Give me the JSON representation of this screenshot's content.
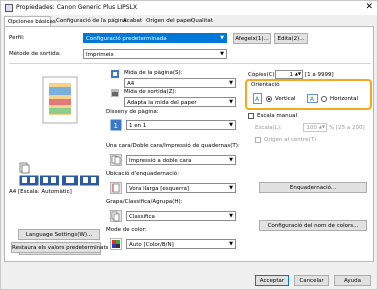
{
  "window": {
    "title": "Propiedades: Canon Generic Plus LIPSLX",
    "close": "✕"
  },
  "tabs": [
    "Opciones básicas",
    "Configuració de la página",
    "Acabat",
    "Origen del paper",
    "Qualitat"
  ],
  "profile": {
    "label": "Perfil:",
    "value": "Configuració predeterminada",
    "add_label": "Afegeix(1)...",
    "edit_label": "Edita(2)..."
  },
  "output": {
    "label": "Mètode de sortida:",
    "value": "Imprimeix"
  },
  "page_size": {
    "label": "Mida de la pàgina(S):",
    "value": "A4"
  },
  "output_size": {
    "label": "Mida de sortida(Z):",
    "value": "Adapta la mida del paper"
  },
  "copies": {
    "label": "Còpies(C):",
    "value": "1",
    "range": "[1 a 9999]"
  },
  "orientation": {
    "label": "Orientació",
    "vertical_label": "Vertical",
    "horizontal_label": "Horizontal",
    "selected": "vertical"
  },
  "layout": {
    "label": "Disseny de pàgina:",
    "value": "1 en 1"
  },
  "scale": {
    "manual_label": "Escala manual",
    "label": "Escala(L):",
    "value": "100",
    "range": "% [25 a 200]"
  },
  "center": {
    "label": "Origen al centre(T)"
  },
  "duplex": {
    "label": "Una cara/Doble cara/Impressió de quadernas(T):",
    "value": "Impressió a doble cara"
  },
  "binding": {
    "label": "Ubicació d'enquadernació:",
    "value": "Vora llarga [esquerra]",
    "button_label": "Enquadernació..."
  },
  "staple": {
    "label": "Grapa/Classifica/Agrupa(H):",
    "value": "Classifica"
  },
  "color_mode": {
    "label": "Mode de color:",
    "value": "Auto [Color/B/N]",
    "button_label": "Configuració del nom de colors..."
  },
  "preview": {
    "caption": "A4 [Escala: Automàtic]"
  },
  "left_buttons": {
    "view_options": "Opcions de vista",
    "language": "Language Settings(W)...",
    "restore": "Restaura els valors predeterminats"
  },
  "bottom_buttons": {
    "ok": "Acceptar",
    "cancel": "Cancelar",
    "help": "Ayuda"
  },
  "colors": {
    "accent": "#0078d7",
    "highlight": "#f5a623"
  }
}
